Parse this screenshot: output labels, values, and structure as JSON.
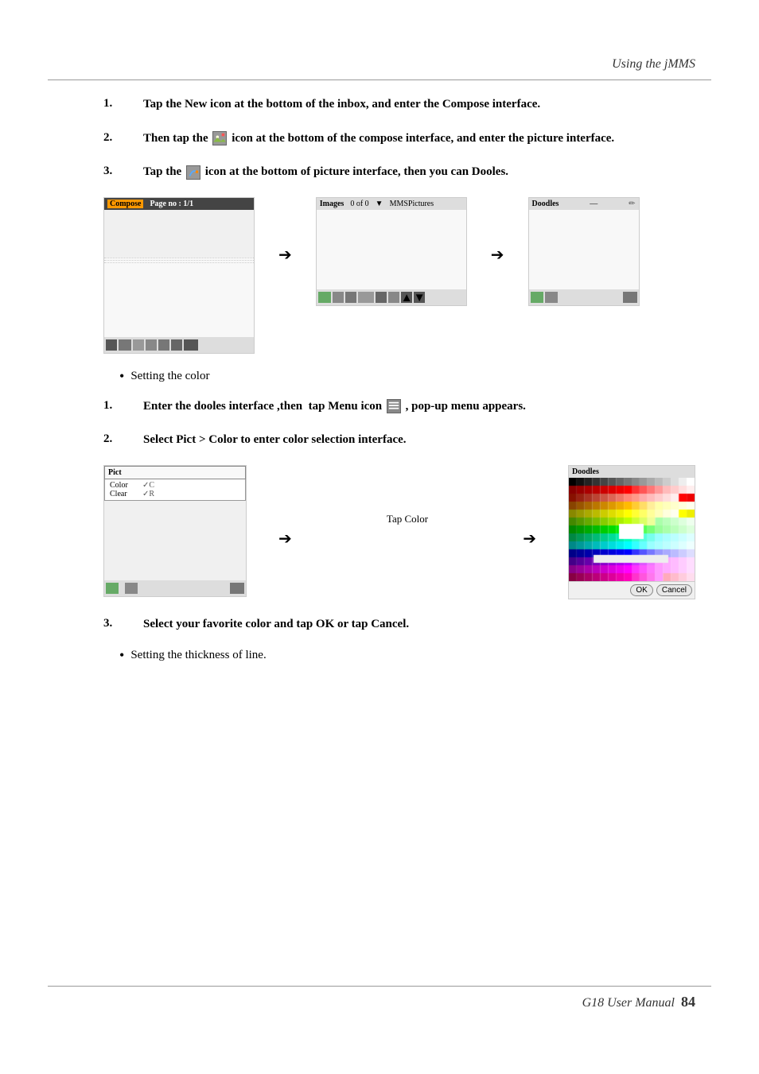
{
  "header": {
    "title": "Using the jMMS"
  },
  "footer": {
    "label": "G18 User Manual",
    "page": "84"
  },
  "steps_intro": [
    {
      "num": "1.",
      "text": "Tap the New icon at the bottom of the inbox, and enter the Compose interface."
    },
    {
      "num": "2.",
      "text": "Then tap the",
      "icon": "image-icon",
      "text2": "icon at the bottom of the compose interface, and enter the picture interface."
    },
    {
      "num": "3.",
      "text": "Tap the",
      "icon": "doodle-icon",
      "text2": "icon at the bottom of picture interface, then you can Dooles."
    }
  ],
  "compose_screen": {
    "header_label": "Compose",
    "header_text": "Page no : 1/1"
  },
  "images_screen": {
    "header_label": "Images",
    "header_count": "0 of 0",
    "header_dropdown": "MMSPictures"
  },
  "doodles_screen": {
    "header_label": "Doodles",
    "header_icon": "—"
  },
  "bullet_color": {
    "text": "Setting the color"
  },
  "steps_color": [
    {
      "num": "1.",
      "text": "Enter the dooles interface ,then  tap Menu icon",
      "icon": "menu-icon",
      "text2": ", pop-up menu appears."
    },
    {
      "num": "2.",
      "text": "Select Pict > Color to enter color selection interface."
    }
  ],
  "pict_menu": {
    "header": "Pict",
    "items": [
      {
        "label": "Color",
        "shortcut": "✓C"
      },
      {
        "label": "Clear",
        "shortcut": "✓R"
      }
    ]
  },
  "tap_color_label": "Tap Color",
  "doodles_color_header": "Doodles",
  "ok_button": "OK",
  "cancel_button": "Cancel",
  "step3_color": {
    "num": "3.",
    "text": "Select your favorite color and tap OK or tap Cancel."
  },
  "bullet_thickness": {
    "text": "Setting the thickness of line."
  },
  "arrows": {
    "right": "➔"
  }
}
